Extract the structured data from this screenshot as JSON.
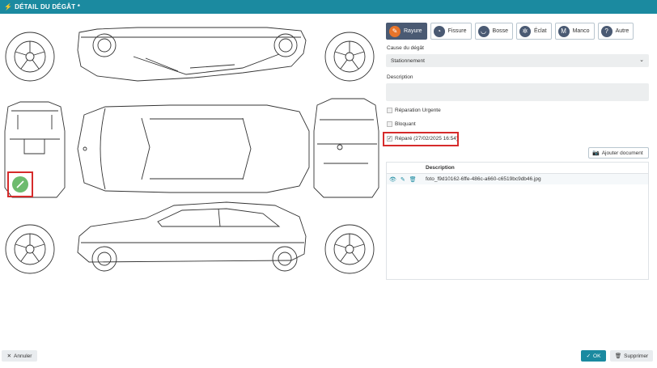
{
  "title": "DÉTAIL DU DÉGÂT *",
  "damage_types": [
    {
      "label": "Rayure",
      "glyph": "✎",
      "active": true
    },
    {
      "label": "Fissure",
      "glyph": "◔",
      "active": false
    },
    {
      "label": "Bosse",
      "glyph": "◡",
      "active": false
    },
    {
      "label": "Éclat",
      "glyph": "✲",
      "active": false
    },
    {
      "label": "Manco",
      "glyph": "M",
      "active": false
    },
    {
      "label": "Autre",
      "glyph": "?",
      "active": false
    }
  ],
  "cause_label": "Cause du dégât",
  "cause_value": "Stationnement",
  "description_label": "Description",
  "checkboxes": {
    "urgent": "Réparation Urgente",
    "blocking": "Bloquant",
    "repaired": "Réparé (27/02/2025 16:54)"
  },
  "add_document_label": "Ajouter document",
  "documents": {
    "header": "Description",
    "rows": [
      {
        "name": "foto_f9d10162-6ffe-486c-a660-c6519bc9db46.jpg"
      }
    ]
  },
  "buttons": {
    "cancel": "Annuler",
    "ok": "OK",
    "delete": "Supprimer"
  },
  "colors": {
    "header_bg": "#1b8aa0",
    "active_button": "#4a5a73",
    "marker": "#6dbb6e",
    "highlight": "#d62b2b"
  },
  "icons": {
    "title": "bolt-icon",
    "add_doc": "camera-icon",
    "view": "eye-icon",
    "edit": "pencil-icon",
    "remove": "trash-icon"
  }
}
